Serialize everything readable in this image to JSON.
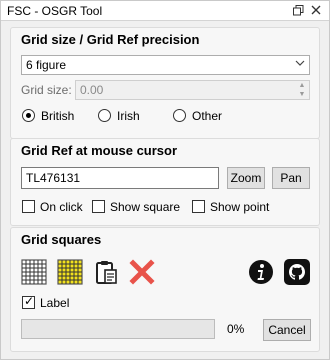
{
  "window": {
    "title": "FSC - OSGR Tool"
  },
  "grid_size_group": {
    "title": "Grid size / Grid Ref precision",
    "precision_value": "6 figure",
    "grid_size_label": "Grid size:",
    "grid_size_value": "0.00",
    "radios": [
      "British",
      "Irish",
      "Other"
    ],
    "selected_radio": "British"
  },
  "mouse_group": {
    "title": "Grid Ref at mouse cursor",
    "grid_ref_value": "TL476131",
    "zoom_label": "Zoom",
    "pan_label": "Pan",
    "checkboxes": [
      "On click",
      "Show square",
      "Show point"
    ]
  },
  "squares_group": {
    "title": "Grid squares",
    "label_checkbox": "Label",
    "label_checked": true,
    "progress_percent": 0,
    "progress_text": "0%",
    "cancel_label": "Cancel"
  }
}
